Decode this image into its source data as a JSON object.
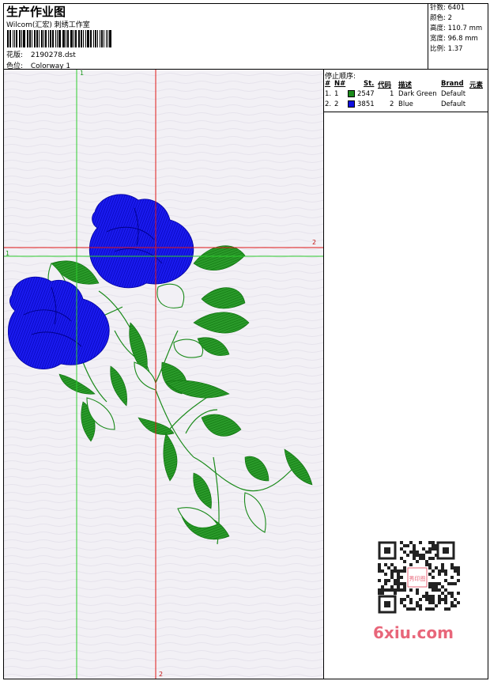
{
  "header": {
    "title": "生产作业图",
    "company": "Wilcom(汇宏) 刺绣工作室",
    "design_label": "花版:",
    "design_file": "2190278.dst",
    "colorway_label": "色位:",
    "colorway": "Colorway 1"
  },
  "stats": [
    {
      "label": "针数:",
      "value": "6401"
    },
    {
      "label": "颜色:",
      "value": "2"
    },
    {
      "label": "高度:",
      "value": "110.7 mm"
    },
    {
      "label": "宽度:",
      "value": "96.8 mm"
    },
    {
      "label": "比例:",
      "value": "1.37"
    }
  ],
  "stop_sequence": {
    "title": "停止顺序:",
    "columns": {
      "num": "#",
      "n": "N#",
      "st": "St.",
      "code": "代码",
      "desc": "描述",
      "brand": "Brand",
      "elem": "元素"
    },
    "rows": [
      {
        "num": "1.",
        "n": "1",
        "color": "#1a8a1a",
        "st": "2547",
        "code": "1",
        "desc": "Dark Green",
        "brand": "Default"
      },
      {
        "num": "2.",
        "n": "2",
        "color": "#1010e0",
        "st": "3851",
        "code": "2",
        "desc": "Blue",
        "brand": "Default"
      }
    ]
  },
  "guides": {
    "green_label": "1",
    "red_label": "2"
  },
  "watermark": "6xiu.com",
  "qr_text": "秀印图"
}
